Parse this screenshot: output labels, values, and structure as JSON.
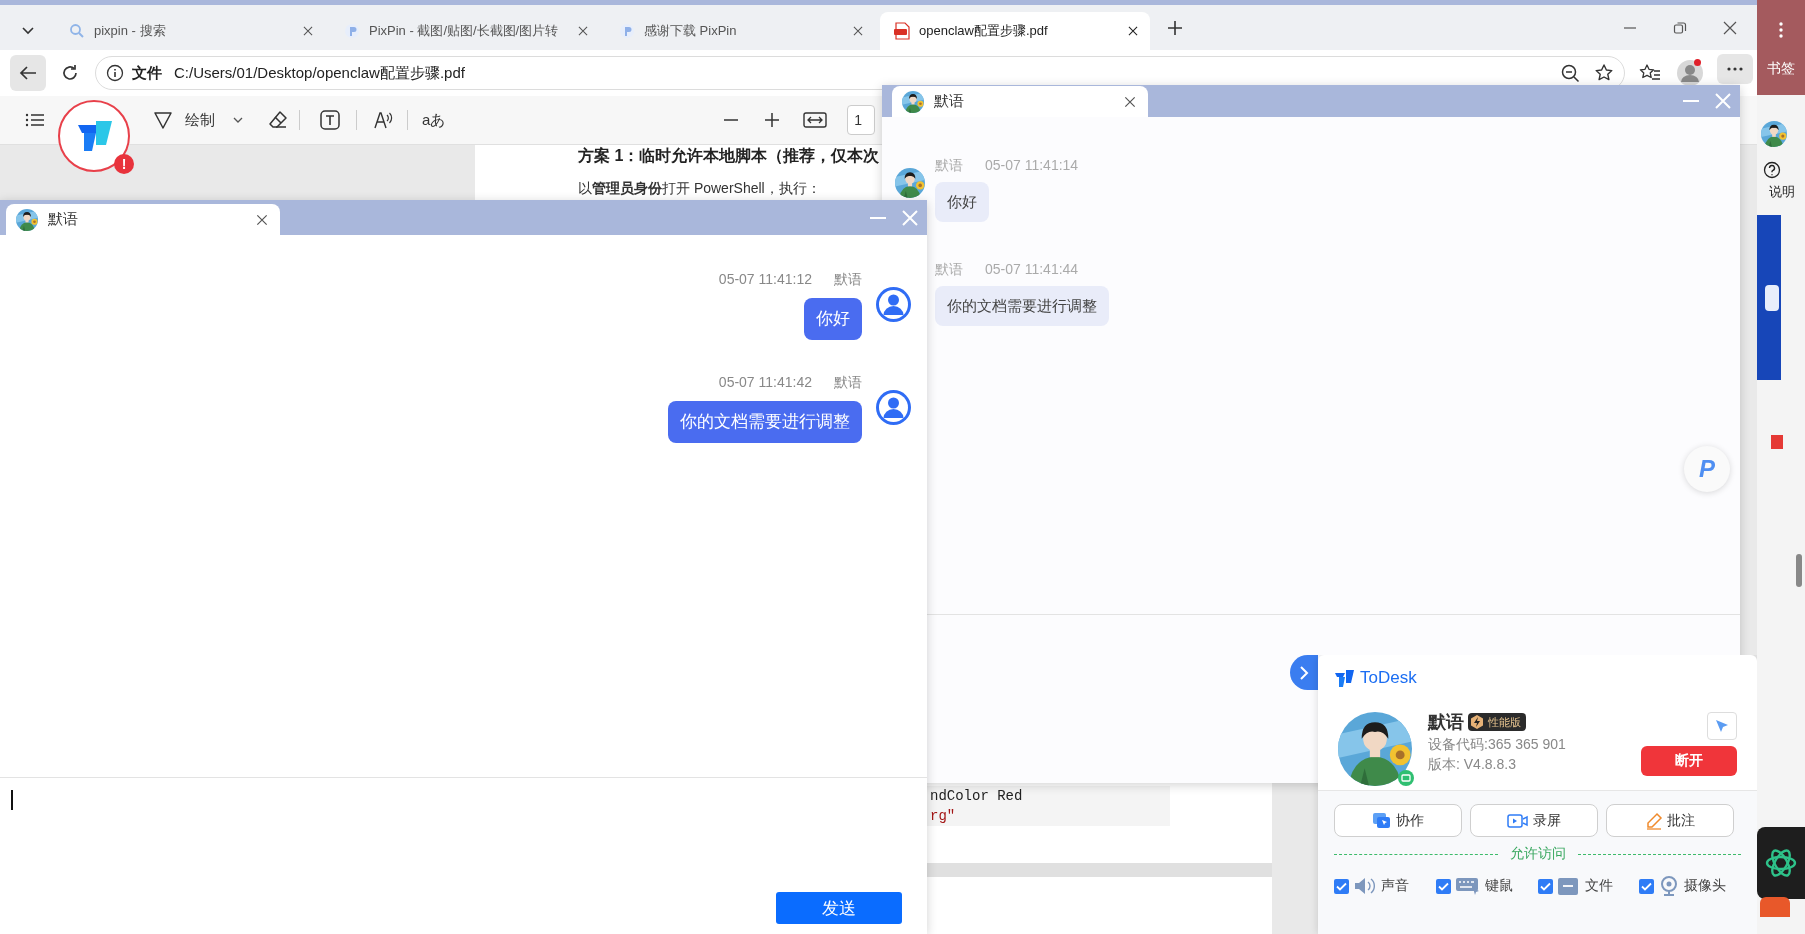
{
  "browser": {
    "tabs": [
      {
        "kind": "search",
        "title": "pixpin - 搜索",
        "selected": false
      },
      {
        "kind": "pixpin",
        "title": "PixPin - 截图/贴图/长截图/图片转",
        "selected": false
      },
      {
        "kind": "pixpin",
        "title": "感谢下载 PixPin",
        "selected": false
      },
      {
        "kind": "pdf",
        "title": "openclaw配置步骤.pdf",
        "selected": true
      }
    ],
    "address": {
      "label": "文件",
      "url": "C:/Users/01/Desktop/openclaw配置步骤.pdf"
    },
    "profile": {
      "notification": true
    }
  },
  "pdf_toolbar": {
    "draw_label": "绘制",
    "immersive_label": "aあ",
    "page": "1"
  },
  "pdf_page": {
    "heading": "方案 1：临时允许本地脚本（推荐，仅本次",
    "paragraph": "以**管理员身份**打开 PowerShell，执行：",
    "code_lines": [
      {
        "kind": "plain",
        "text": "ndColor Red"
      },
      {
        "kind": "string",
        "text": "rg\""
      }
    ]
  },
  "todesk_float": {
    "badge": "!"
  },
  "chat_windows": [
    {
      "title": "默语",
      "kind": "outgoing",
      "messages": [
        {
          "time": "05-07 11:41:12",
          "sender": "默语",
          "text": "你好"
        },
        {
          "time": "05-07 11:41:42",
          "sender": "默语",
          "text": "你的文档需要进行调整"
        }
      ],
      "send_button": "发送"
    },
    {
      "title": "默语",
      "kind": "incoming",
      "messages": [
        {
          "time": "05-07 11:41:14",
          "sender": "默语",
          "text": "你好"
        },
        {
          "time": "05-07 11:41:44",
          "sender": "默语",
          "text": "你的文档需要进行调整"
        }
      ]
    }
  ],
  "pixpin_float": {
    "label": "P"
  },
  "todesk": {
    "brand": "ToDesk",
    "name": "默语",
    "tier": "性能版",
    "device_code": "设备代码:365 365 901",
    "version": "版本: V4.8.8.3",
    "disconnect": "断开",
    "actions": [
      {
        "kind": "collab",
        "label": "协作"
      },
      {
        "kind": "record",
        "label": "录屏"
      },
      {
        "kind": "annotate",
        "label": "批注"
      }
    ],
    "section": "允许访问",
    "permissions": [
      {
        "kind": "sound",
        "label": "声音",
        "checked": true
      },
      {
        "kind": "keyboard",
        "label": "键鼠",
        "checked": true
      },
      {
        "kind": "file",
        "label": "文件",
        "checked": true
      },
      {
        "kind": "camera",
        "label": "摄像头",
        "checked": true
      }
    ]
  },
  "side_strip": {
    "bookmarks": "书签",
    "help": "说明"
  }
}
